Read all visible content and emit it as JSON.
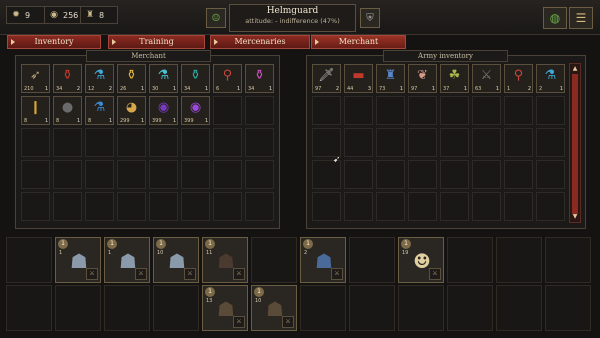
{
  "resources": [
    {
      "icon": "gear-icon",
      "glyph": "✹",
      "value": "9"
    },
    {
      "icon": "coin-icon",
      "glyph": "◉",
      "value": "256"
    },
    {
      "icon": "mercenary-icon",
      "glyph": "♜",
      "value": "8"
    }
  ],
  "header": {
    "name": "Helmguard",
    "attitude": "attitude: - indifference (47%)"
  },
  "tabs": [
    {
      "label": "Inventory"
    },
    {
      "label": "Training"
    },
    {
      "label": "Mercenaries"
    },
    {
      "label": "Merchant"
    }
  ],
  "merchant": {
    "title": "Merchant",
    "items": [
      {
        "icon": "crossbow-bolts-icon",
        "glyph": "➶",
        "color": "#b9a27c",
        "price": "210",
        "qty": "1"
      },
      {
        "icon": "red-potion-icon",
        "glyph": "⚱",
        "color": "#c0392b",
        "price": "34",
        "qty": "2"
      },
      {
        "icon": "blue-flask-icon",
        "glyph": "⚗",
        "color": "#3fa6d8",
        "price": "12",
        "qty": "2"
      },
      {
        "icon": "yellow-jar-icon",
        "glyph": "⚱",
        "color": "#e0b33a",
        "price": "26",
        "qty": "1"
      },
      {
        "icon": "cyan-flask-icon",
        "glyph": "⚗",
        "color": "#48c0d0",
        "price": "30",
        "qty": "1"
      },
      {
        "icon": "teal-potion-icon",
        "glyph": "⚱",
        "color": "#2aa8a0",
        "price": "34",
        "qty": "1"
      },
      {
        "icon": "red-vial-icon",
        "glyph": "⚲",
        "color": "#c8453a",
        "price": "6",
        "qty": "1"
      },
      {
        "icon": "magenta-potion-icon",
        "glyph": "⚱",
        "color": "#c44fb8",
        "price": "34",
        "qty": "1"
      },
      {
        "icon": "torch-icon",
        "glyph": "❙",
        "color": "#d8a43a",
        "price": "8",
        "qty": "1"
      },
      {
        "icon": "bomb-icon",
        "glyph": "●",
        "color": "#6a6a6a",
        "price": "8",
        "qty": "1"
      },
      {
        "icon": "blue-vial-icon",
        "glyph": "⚗",
        "color": "#3a8ad0",
        "price": "8",
        "qty": "1"
      },
      {
        "icon": "golden-horn-icon",
        "glyph": "◕",
        "color": "#d6a84a",
        "price": "299",
        "qty": "1"
      },
      {
        "icon": "purple-orb-icon",
        "glyph": "◉",
        "color": "#7a3ac0",
        "price": "399",
        "qty": "1"
      },
      {
        "icon": "violet-orb-icon",
        "glyph": "◉",
        "color": "#9a4ad8",
        "price": "399",
        "qty": "1"
      }
    ]
  },
  "army_inventory": {
    "title": "Army inventory",
    "items": [
      {
        "icon": "dagger-icon",
        "glyph": "🗡",
        "color": "#b8b8b8",
        "price": "97",
        "qty": "2"
      },
      {
        "icon": "red-banner-icon",
        "glyph": "▬",
        "color": "#c0392b",
        "price": "44",
        "qty": "3"
      },
      {
        "icon": "blue-armor-icon",
        "glyph": "♜",
        "color": "#5a86c8",
        "price": "73",
        "qty": "1"
      },
      {
        "icon": "feather-scroll-icon",
        "glyph": "❦",
        "color": "#d49a8a",
        "price": "97",
        "qty": "1"
      },
      {
        "icon": "herb-icon",
        "glyph": "☘",
        "color": "#a8b84a",
        "price": "37",
        "qty": "1"
      },
      {
        "icon": "black-blade-icon",
        "glyph": "⚔",
        "color": "#777777",
        "price": "63",
        "qty": "1"
      },
      {
        "icon": "red-vial-icon",
        "glyph": "⚲",
        "color": "#c8453a",
        "price": "1",
        "qty": "2"
      },
      {
        "icon": "blue-flask-icon",
        "glyph": "⚗",
        "color": "#3fa6d8",
        "price": "2",
        "qty": "1"
      }
    ]
  },
  "party_top": [
    {
      "slot": 1,
      "level": "1",
      "icon": "knight-portrait-icon",
      "glyph": "☗",
      "color": "#8a9aaa",
      "tag": "1"
    },
    {
      "slot": 2,
      "level": "1",
      "icon": "knight-portrait-icon",
      "glyph": "☗",
      "color": "#8a9aaa",
      "tag": "1"
    },
    {
      "slot": 3,
      "level": "1",
      "icon": "knight-portrait-icon",
      "glyph": "☗",
      "color": "#8a9aaa",
      "tag": "10"
    },
    {
      "slot": 4,
      "level": "1",
      "icon": "musketeer-portrait-icon",
      "glyph": "☗",
      "color": "#4a3a30",
      "tag": "11"
    },
    {
      "slot": 6,
      "level": "1",
      "icon": "blue-soldier-portrait-icon",
      "glyph": "☗",
      "color": "#4a6a9a",
      "tag": "2"
    },
    {
      "slot": 8,
      "level": "1",
      "icon": "blonde-woman-portrait-icon",
      "glyph": "☻",
      "color": "#e0cfa0",
      "tag": "19"
    }
  ],
  "party_bottom": [
    {
      "slot": 4,
      "level": "1",
      "icon": "hooded-archer-portrait-icon",
      "glyph": "☗",
      "color": "#5a4a38",
      "tag": "13"
    },
    {
      "slot": 5,
      "level": "1",
      "icon": "hooded-rogue-portrait-icon",
      "glyph": "☗",
      "color": "#5a4a38",
      "tag": "10"
    }
  ]
}
